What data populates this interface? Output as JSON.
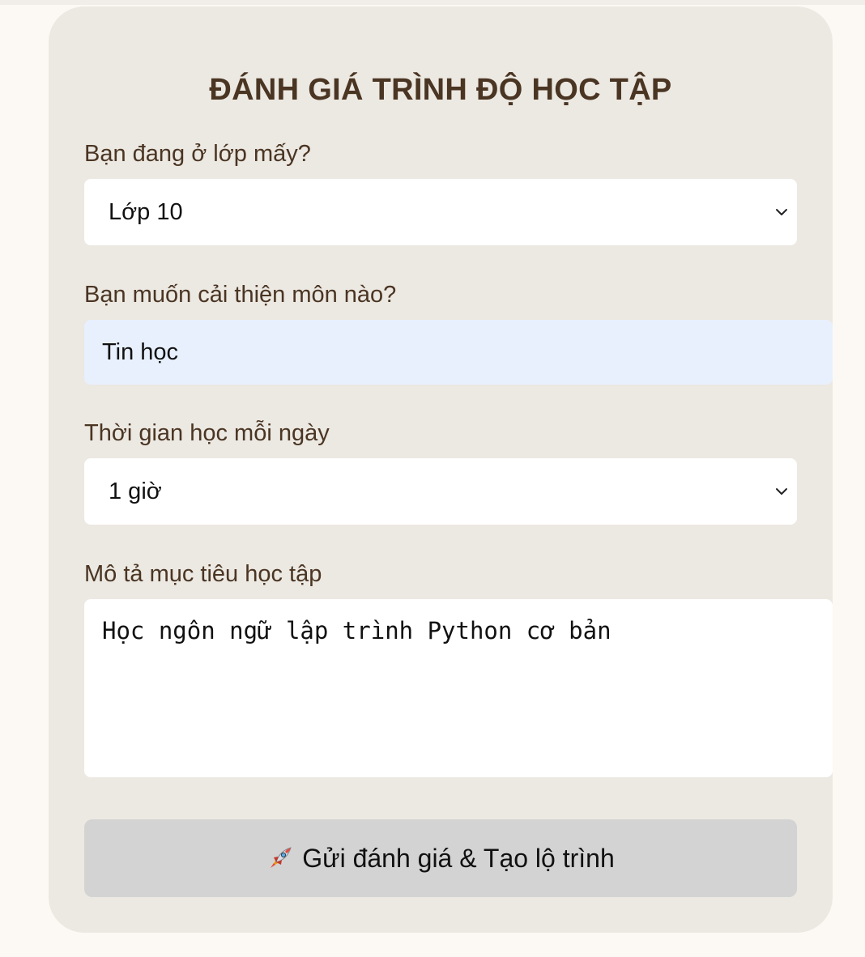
{
  "form": {
    "title": "ĐÁNH GIÁ TRÌNH ĐỘ HỌC TẬP",
    "grade": {
      "label": "Bạn đang ở lớp mấy?",
      "selected": "Lớp 10"
    },
    "subject": {
      "label": "Bạn muốn cải thiện môn nào?",
      "value": "Tin học"
    },
    "study_time": {
      "label": "Thời gian học mỗi ngày",
      "selected": "1 giờ"
    },
    "goal": {
      "label": "Mô tả mục tiêu học tập",
      "value": "Học ngôn ngữ lập trình Python cơ bản"
    },
    "submit": {
      "icon": "rocket-icon",
      "label": "Gửi đánh giá & Tạo lộ trình"
    }
  },
  "colors": {
    "page_background": "#fcf9f4",
    "card_background": "#ece8e2",
    "text_brown": "#4a3523",
    "input_autofill": "#e8f0fe",
    "button_background": "#d3d3d3"
  }
}
